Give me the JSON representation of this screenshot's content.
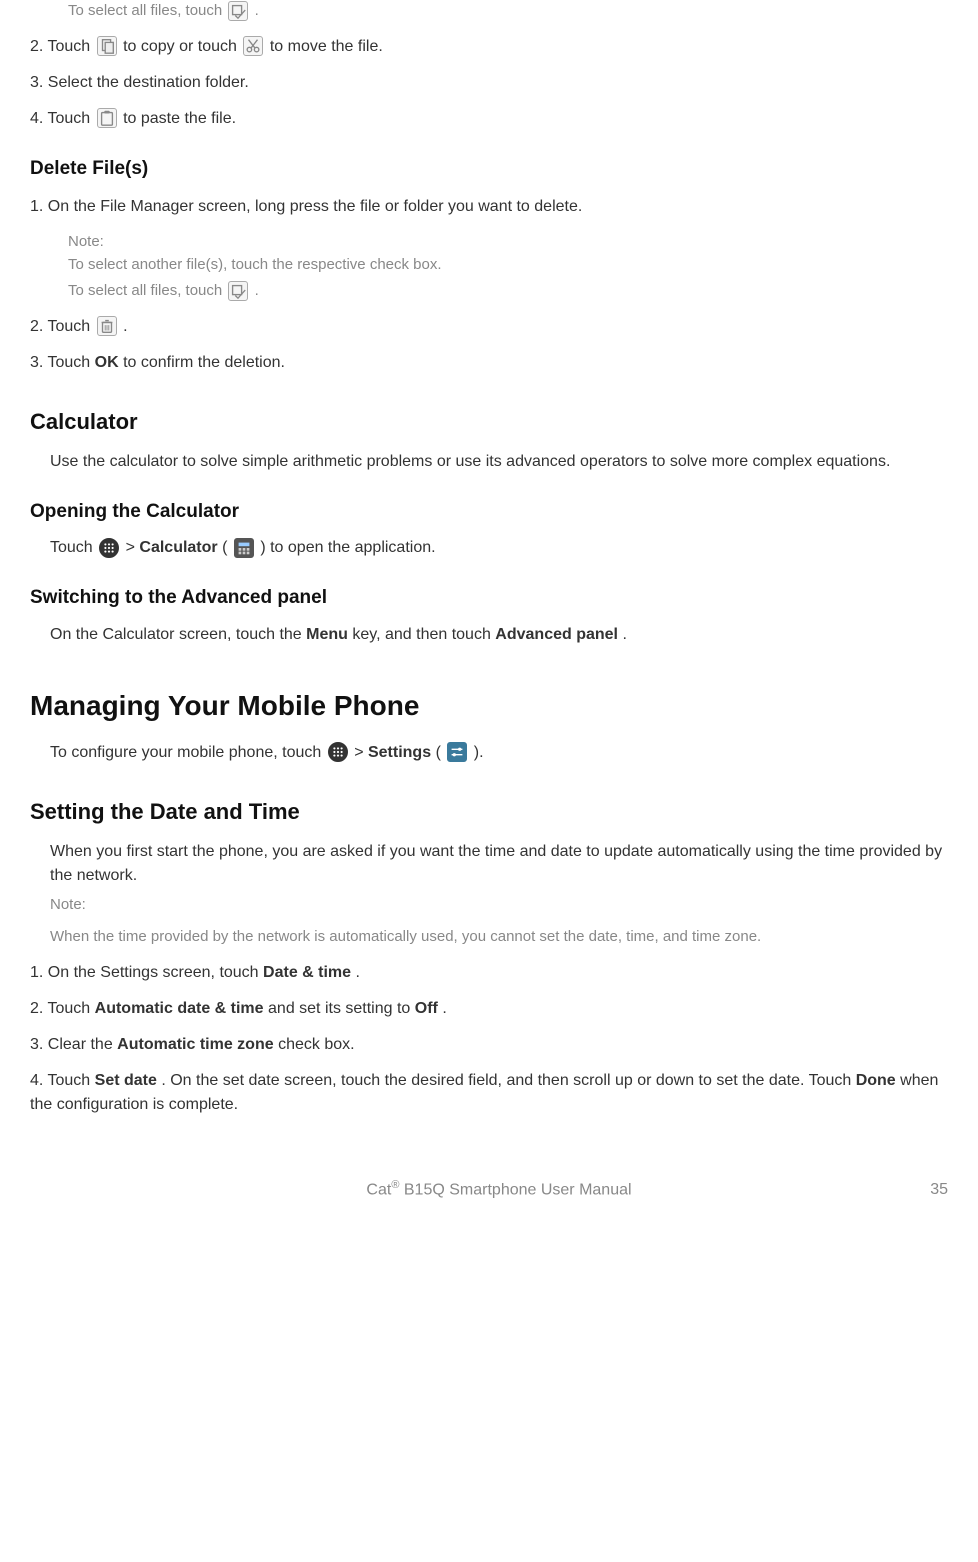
{
  "top": {
    "select_all_prefix": "To select all files, touch ",
    "select_all_suffix": ".",
    "step2_a": "2. Touch ",
    "step2_b": " to copy or touch ",
    "step2_c": " to move the file.",
    "step3": "3. Select the destination folder.",
    "step4_a": "4. Touch ",
    "step4_b": " to paste the file."
  },
  "delete": {
    "heading": "Delete File(s)",
    "step1": "1. On the File Manager screen, long press the file or folder you want to delete.",
    "note_label": "Note:",
    "note_line1": "To select another file(s), touch the respective check box.",
    "note_line2_prefix": "To select all files, touch ",
    "note_line2_suffix": ".",
    "step2_a": "2. Touch ",
    "step2_b": ".",
    "step3_a": "3. Touch ",
    "step3_bold": "OK",
    "step3_b": " to confirm the deletion."
  },
  "calculator": {
    "heading": "Calculator",
    "intro": "Use the calculator to solve simple arithmetic problems or use its advanced operators to solve more complex equations.",
    "opening_heading": "Opening the Calculator",
    "opening_a": "Touch ",
    "opening_b": " > ",
    "opening_bold": "Calculator",
    "opening_c": " (",
    "opening_d": ") to open the application.",
    "advanced_heading": "Switching to the Advanced panel",
    "advanced_a": "On the Calculator screen, touch the ",
    "advanced_bold1": "Menu",
    "advanced_b": " key, and then touch ",
    "advanced_bold2": "Advanced panel",
    "advanced_c": "."
  },
  "managing": {
    "heading": "Managing Your Mobile Phone",
    "intro_a": "To configure your mobile phone, touch ",
    "intro_b": " > ",
    "intro_bold": "Settings",
    "intro_c": " (",
    "intro_d": ")."
  },
  "datetime": {
    "heading": "Setting the Date and Time",
    "intro": "When you first start the phone, you are asked if you want the time and date to update automatically using the time provided by the network.",
    "note_label": "Note:",
    "note_body": "When the time provided by the network is automatically used, you cannot set the date, time, and time zone.",
    "step1_a": "1. On the Settings screen, touch ",
    "step1_bold": "Date & time",
    "step1_b": ".",
    "step2_a": "2. Touch ",
    "step2_bold1": "Automatic date & time",
    "step2_b": " and set its setting to ",
    "step2_bold2": "Off",
    "step2_c": ".",
    "step3_a": "3. Clear the ",
    "step3_bold": "Automatic time zone",
    "step3_b": " check box.",
    "step4_a": "4. Touch ",
    "step4_bold1": "Set date",
    "step4_b": ". On the set date screen, touch the desired field, and then scroll up or down to set the date. Touch ",
    "step4_bold2": "Done",
    "step4_c": " when the configuration is complete."
  },
  "footer": {
    "title_a": "Cat",
    "title_b": " B15Q Smartphone User Manual",
    "page": "35"
  }
}
